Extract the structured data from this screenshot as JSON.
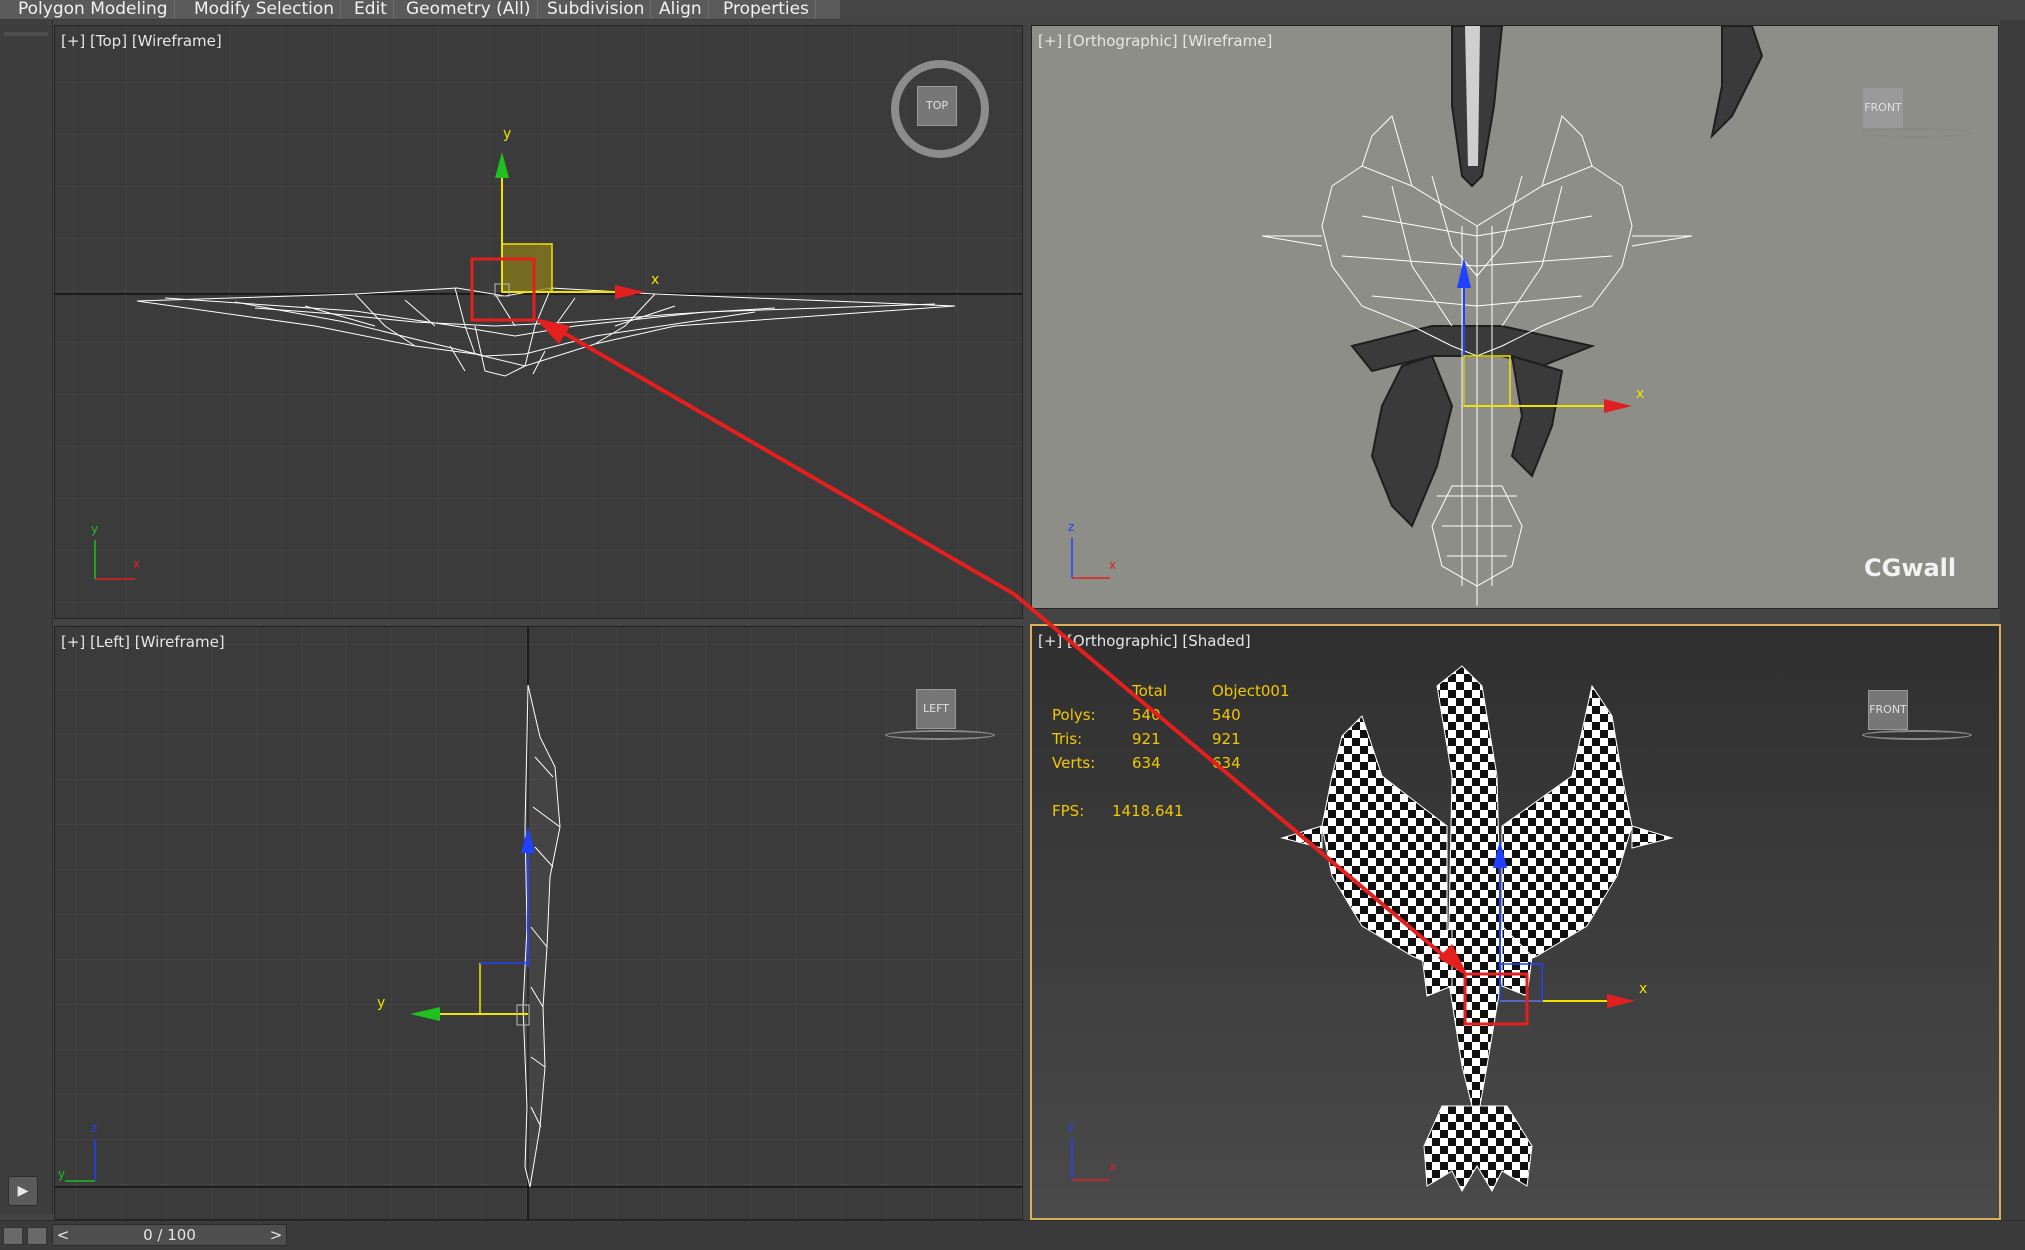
{
  "ribbon": {
    "tabs": [
      "Polygon Modeling",
      "Modify Selection",
      "Edit",
      "Geometry (All)",
      "Subdivision",
      "Align",
      "Properties"
    ]
  },
  "viewports": {
    "top": {
      "label": "[+] [Top] [Wireframe]",
      "cube": "TOP",
      "axis_y": "y",
      "axis_x": "x"
    },
    "front": {
      "label": "[+] [Orthographic] [Wireframe]",
      "cube": "FRONT",
      "axis_z": "z",
      "axis_x": "x",
      "watermark": "CGwall"
    },
    "left": {
      "label": "[+] [Left] [Wireframe]",
      "cube": "LEFT",
      "axis_z": "z",
      "axis_y": "y"
    },
    "shaded": {
      "label": "[+] [Orthographic] [Shaded]",
      "cube": "FRONT",
      "axis_z": "z",
      "axis_x": "x"
    }
  },
  "stats": {
    "header_total": "Total",
    "header_object": "Object001",
    "rows": [
      {
        "label": "Polys:",
        "total": "540",
        "object": "540"
      },
      {
        "label": "Tris:",
        "total": "921",
        "object": "921"
      },
      {
        "label": "Verts:",
        "total": "634",
        "object": "634"
      }
    ],
    "fps_label": "FPS:",
    "fps_value": "1418.641"
  },
  "timeline": {
    "frame": "0 / 100",
    "prev": "<",
    "next": ">"
  },
  "icons": {
    "play": "play-icon"
  },
  "colors": {
    "annotation": "#e51e1e",
    "gizmo_x": "#e02020",
    "gizmo_y": "#20c020",
    "gizmo_z": "#2040ff",
    "active_border": "#d9b15a"
  }
}
